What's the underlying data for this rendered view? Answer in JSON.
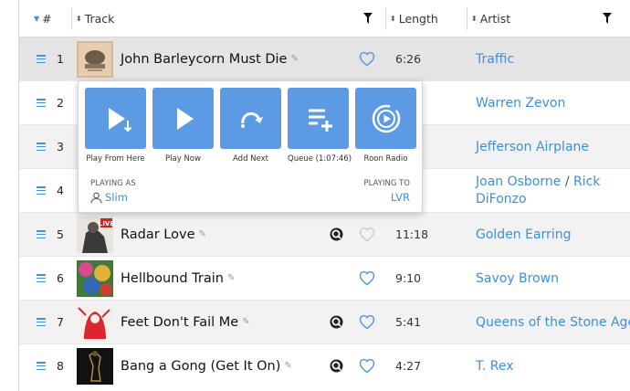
{
  "header": {
    "number_label": "#",
    "track_label": "Track",
    "length_label": "Length",
    "artist_label": "Artist"
  },
  "colors": {
    "accent": "#3d8fdc",
    "tile": "#5c9ae3",
    "row_alt": "#f2f2f2",
    "row_selected": "#e4e4e4"
  },
  "rows": [
    {
      "num": "1",
      "title": "John Barleycorn Must Die",
      "length": "6:26",
      "artist": "Traffic",
      "qobuz": false,
      "heart_icon": "heart-outline-blue"
    },
    {
      "num": "2",
      "title": "",
      "length": "",
      "artist": "Warren Zevon",
      "qobuz": false,
      "heart_icon": ""
    },
    {
      "num": "3",
      "title": "",
      "length": "",
      "artist": "Jefferson Airplane",
      "qobuz": false,
      "heart_icon": ""
    },
    {
      "num": "4",
      "title": "",
      "length": "",
      "artist": "Joan Osborne",
      "artist_sep": "/",
      "artist2": "Rick",
      "artist2_line2": "DiFonzo",
      "qobuz": false,
      "heart_icon": ""
    },
    {
      "num": "5",
      "title": "Radar Love",
      "length": "11:18",
      "artist": "Golden Earring",
      "qobuz": true,
      "heart_icon": "heart-outline-grey"
    },
    {
      "num": "6",
      "title": "Hellbound Train",
      "length": "9:10",
      "artist": "Savoy Brown",
      "qobuz": false,
      "heart_icon": "heart-outline-blue"
    },
    {
      "num": "7",
      "title": "Feet Don't Fail Me",
      "length": "5:41",
      "artist": "Queens of the Stone Age",
      "qobuz": true,
      "heart_icon": "heart-outline-blue"
    },
    {
      "num": "8",
      "title": "Bang a Gong (Get It On)",
      "length": "4:27",
      "artist": "T. Rex",
      "qobuz": true,
      "heart_icon": "heart-outline-blue"
    }
  ],
  "art_badges": {
    "row5": "LIVE"
  },
  "popup": {
    "buttons": [
      {
        "label": "Play From Here",
        "icon": "play-from-here-icon"
      },
      {
        "label": "Play Now",
        "icon": "play-now-icon"
      },
      {
        "label": "Add Next",
        "icon": "add-next-icon"
      },
      {
        "label": "Queue (1:07:46)",
        "icon": "queue-add-icon"
      },
      {
        "label": "Roon Radio",
        "icon": "roon-radio-icon"
      }
    ],
    "playing_as_caption": "PLAYING AS",
    "playing_as_value": "Slim",
    "playing_to_caption": "PLAYING TO",
    "playing_to_value": "LVR"
  }
}
